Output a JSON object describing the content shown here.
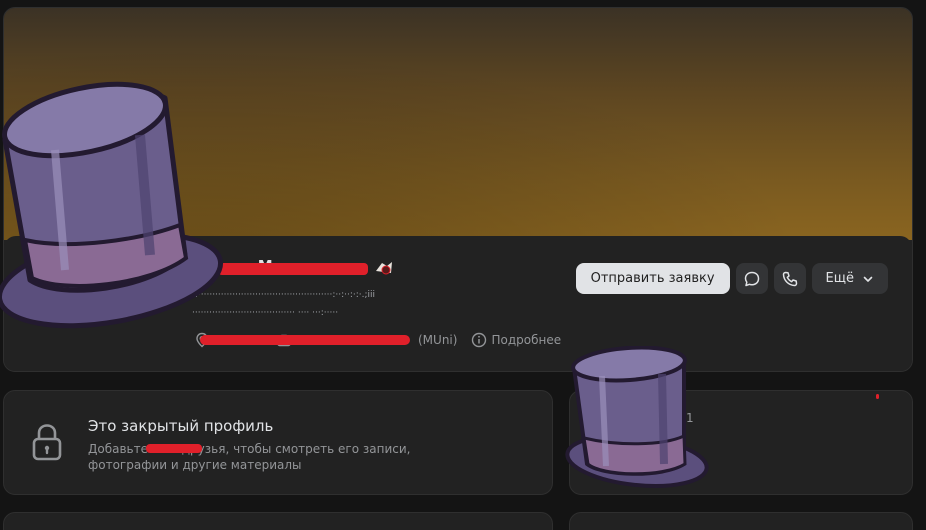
{
  "profile": {
    "name": "· · · М· · · · ·",
    "status_line_1": "·:···············································:··:··:·:·.;iii",
    "status_line_2": "···································· ···· ···:·····",
    "meta": {
      "work_text": "(MUni)",
      "details_label": "Подробнее"
    }
  },
  "actions": {
    "send_request_label": "Отправить заявку",
    "more_label": "Ещё"
  },
  "closed_profile": {
    "title": "Это закрытый профиль",
    "description": "Добавьте ···· в друзья, чтобы смотреть его записи, фотографии и другие материалы"
  },
  "side_card": {
    "count": "1"
  },
  "colors": {
    "accent": "#e0202a",
    "button_light": "#e1e3e6",
    "card": "#222222",
    "hat": "#6a5e8c"
  },
  "icons": [
    "location-icon",
    "briefcase-icon",
    "info-icon",
    "message-icon",
    "phone-icon",
    "chevron-down-icon",
    "lock-icon",
    "top-hat-icon"
  ]
}
